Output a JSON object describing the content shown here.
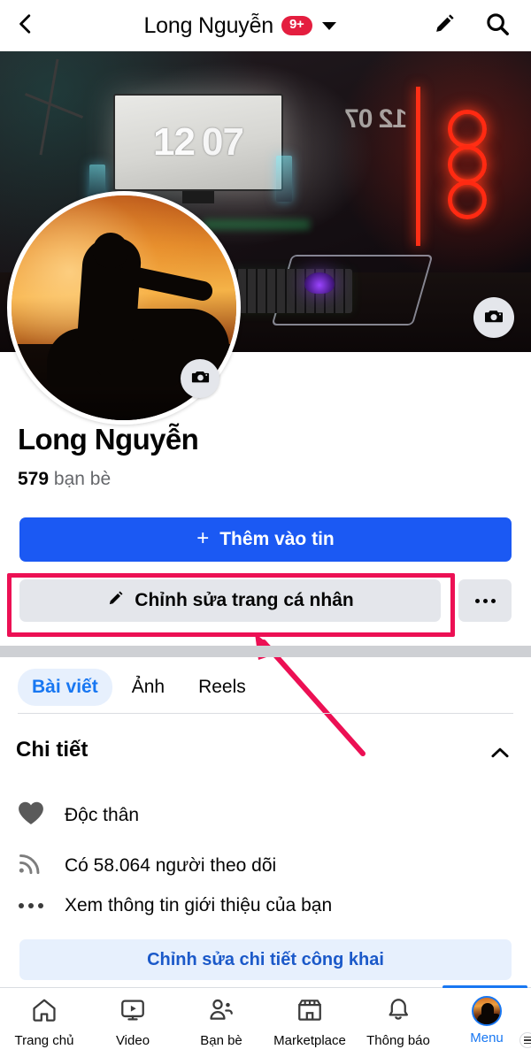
{
  "header": {
    "back_icon": "chevron-left-icon",
    "title": "Long Nguyễn",
    "badge": "9+",
    "dropdown_icon": "chevron-down-icon",
    "edit_icon": "pencil-icon",
    "search_icon": "search-icon"
  },
  "cover": {
    "camera_icon": "camera-icon",
    "clock_hours": "12",
    "clock_minutes": "07",
    "mirror_text": "12 07"
  },
  "avatar": {
    "camera_icon": "camera-icon",
    "alt_name": "profile-photo"
  },
  "profile": {
    "name": "Long Nguyễn",
    "friends_count": "579",
    "friends_label": "bạn bè"
  },
  "actions": {
    "add_story_label": "Thêm vào tin",
    "add_story_plus": "+",
    "edit_profile_label": "Chỉnh sửa trang cá nhân",
    "edit_profile_icon": "pencil-icon",
    "more_icon": "ellipsis-icon",
    "highlight_color": "#EC1054",
    "primary_color": "#1B59F3",
    "secondary_bg": "#E4E6EB"
  },
  "annotation": {
    "arrow_color": "#EC1054",
    "highlight_target": "edit-profile-button"
  },
  "tabs": [
    {
      "label": "Bài viết",
      "active": true
    },
    {
      "label": "Ảnh",
      "active": false
    },
    {
      "label": "Reels",
      "active": false
    }
  ],
  "details": {
    "title": "Chi tiết",
    "collapse_icon": "chevron-up-icon",
    "rows": [
      {
        "icon": "heart-icon",
        "text": "Độc thân"
      },
      {
        "icon": "rss-icon",
        "text": "Có 58.064 người theo dõi"
      },
      {
        "icon": "ellipsis-icon",
        "text": "Xem thông tin giới thiệu của bạn"
      }
    ],
    "public_button_label": "Chỉnh sửa chi tiết công khai",
    "public_button_color": "#1B59C9"
  },
  "bottom_nav": {
    "active_color": "#1877F2",
    "items": [
      {
        "label": "Trang chủ",
        "icon": "home-icon",
        "active": false
      },
      {
        "label": "Video",
        "icon": "video-icon",
        "active": false
      },
      {
        "label": "Bạn bè",
        "icon": "friends-icon",
        "active": false
      },
      {
        "label": "Marketplace",
        "icon": "marketplace-icon",
        "active": false
      },
      {
        "label": "Thông báo",
        "icon": "bell-icon",
        "active": false
      },
      {
        "label": "Menu",
        "icon": "avatar-menu-icon",
        "active": true
      }
    ]
  }
}
